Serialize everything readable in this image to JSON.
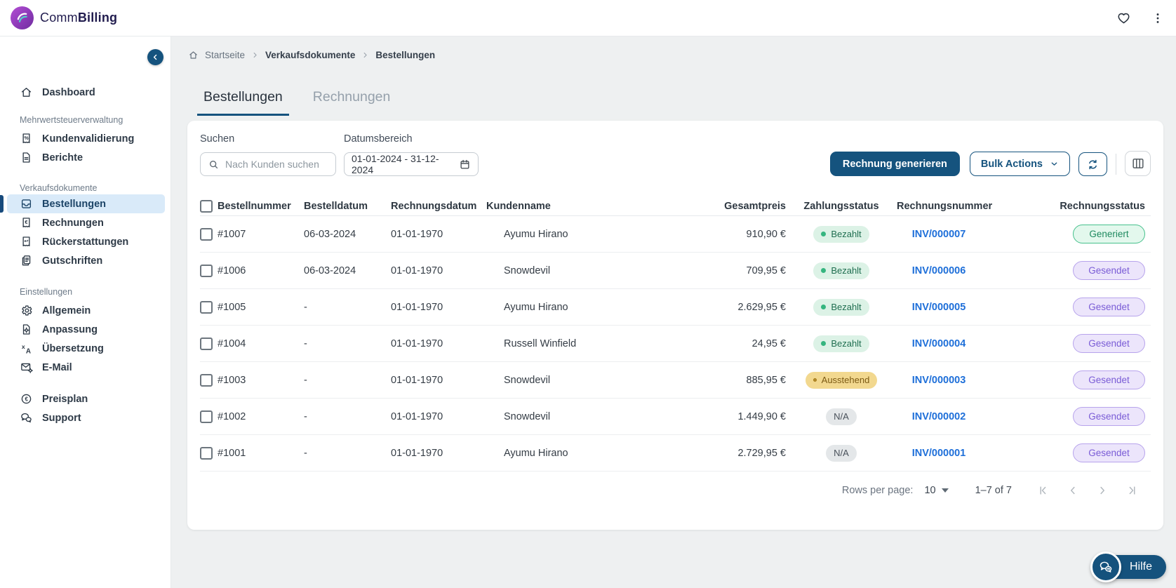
{
  "brand": {
    "comm": "Comm",
    "billing": "Billing"
  },
  "topbar": {
    "icons": [
      "heart-icon",
      "kebab-menu-icon"
    ]
  },
  "sidebar": {
    "collapse_icon": "chevron-left",
    "items": [
      {
        "type": "item",
        "label": "Dashboard",
        "icon": "home",
        "active": false,
        "gap": "mt14"
      },
      {
        "type": "section",
        "label": "Mehrwertsteuerverwaltung",
        "gap": "mt17"
      },
      {
        "type": "item",
        "label": "Kundenvalidierung",
        "icon": "receipt-percent",
        "active": false,
        "gap": "mt4"
      },
      {
        "type": "item",
        "label": "Berichte",
        "icon": "document",
        "active": false
      },
      {
        "type": "section",
        "label": "Verkaufsdokumente",
        "gap": "mt21"
      },
      {
        "type": "item",
        "label": "Bestellungen",
        "icon": "inbox",
        "active": true,
        "gap": "mt4"
      },
      {
        "type": "item",
        "label": "Rechnungen",
        "icon": "receipt-euro",
        "active": false
      },
      {
        "type": "item",
        "label": "Rückerstattungen",
        "icon": "receipt-refund",
        "active": false
      },
      {
        "type": "item",
        "label": "Gutschriften",
        "icon": "copy-note",
        "active": false
      },
      {
        "type": "section",
        "label": "Einstellungen",
        "gap": "mt22"
      },
      {
        "type": "item",
        "label": "Allgemein",
        "icon": "gear",
        "active": false,
        "gap": "mt4"
      },
      {
        "type": "item",
        "label": "Anpassung",
        "icon": "doc-gear",
        "active": false
      },
      {
        "type": "item",
        "label": "Übersetzung",
        "icon": "translate",
        "active": false
      },
      {
        "type": "item",
        "label": "E-Mail",
        "icon": "mail-gear",
        "active": false
      },
      {
        "type": "item",
        "label": "Preisplan",
        "icon": "euro-circle",
        "active": false,
        "gap": "mt18"
      },
      {
        "type": "item",
        "label": "Support",
        "icon": "chat",
        "active": false
      }
    ]
  },
  "breadcrumb": {
    "items": [
      "Startseite",
      "Verkaufsdokumente",
      "Bestellungen"
    ]
  },
  "tabs": [
    {
      "label": "Bestellungen",
      "active": true
    },
    {
      "label": "Rechnungen",
      "active": false
    }
  ],
  "filters": {
    "search_label": "Suchen",
    "search_placeholder": "Nach Kunden suchen",
    "date_label": "Datumsbereich",
    "date_value": "01-01-2024 - 31-12-2024"
  },
  "actions": {
    "generate_invoice": "Rechnung generieren",
    "bulk_actions": "Bulk Actions"
  },
  "table": {
    "columns": [
      "Bestellnummer",
      "Bestelldatum",
      "Rechnungsdatum",
      "Kundenname",
      "Gesamtpreis",
      "Zahlungsstatus",
      "Rechnungsnummer",
      "Rechnungsstatus"
    ],
    "rows": [
      {
        "order": "#1007",
        "order_date": "06-03-2024",
        "invoice_date": "01-01-1970",
        "customer": "Ayumu Hirano",
        "total": "910,90 €",
        "payment": "Bezahlt",
        "payment_type": "paid",
        "invoice": "INV/000007",
        "status": "Generiert",
        "status_type": "generated"
      },
      {
        "order": "#1006",
        "order_date": "06-03-2024",
        "invoice_date": "01-01-1970",
        "customer": "Snowdevil",
        "total": "709,95 €",
        "payment": "Bezahlt",
        "payment_type": "paid",
        "invoice": "INV/000006",
        "status": "Gesendet",
        "status_type": "sent"
      },
      {
        "order": "#1005",
        "order_date": "-",
        "invoice_date": "01-01-1970",
        "customer": "Ayumu Hirano",
        "total": "2.629,95 €",
        "payment": "Bezahlt",
        "payment_type": "paid",
        "invoice": "INV/000005",
        "status": "Gesendet",
        "status_type": "sent"
      },
      {
        "order": "#1004",
        "order_date": "-",
        "invoice_date": "01-01-1970",
        "customer": "Russell Winfield",
        "total": "24,95 €",
        "payment": "Bezahlt",
        "payment_type": "paid",
        "invoice": "INV/000004",
        "status": "Gesendet",
        "status_type": "sent"
      },
      {
        "order": "#1003",
        "order_date": "-",
        "invoice_date": "01-01-1970",
        "customer": "Snowdevil",
        "total": "885,95 €",
        "payment": "Ausstehend",
        "payment_type": "pending",
        "invoice": "INV/000003",
        "status": "Gesendet",
        "status_type": "sent"
      },
      {
        "order": "#1002",
        "order_date": "-",
        "invoice_date": "01-01-1970",
        "customer": "Snowdevil",
        "total": "1.449,90 €",
        "payment": "N/A",
        "payment_type": "na",
        "invoice": "INV/000002",
        "status": "Gesendet",
        "status_type": "sent"
      },
      {
        "order": "#1001",
        "order_date": "-",
        "invoice_date": "01-01-1970",
        "customer": "Ayumu Hirano",
        "total": "2.729,95 €",
        "payment": "N/A",
        "payment_type": "na",
        "invoice": "INV/000001",
        "status": "Gesendet",
        "status_type": "sent"
      }
    ]
  },
  "pagination": {
    "rows_per_page_label": "Rows per page:",
    "rows_per_page_value": "10",
    "range_label": "1–7 of 7"
  },
  "help": {
    "label": "Hilfe"
  },
  "colors": {
    "primary": "#15537e",
    "link_blue": "#1e6fd9",
    "sidebar_active_bg": "#d9eaf9",
    "paid_bg": "#dcf2e6",
    "paid_text": "#1f6e50",
    "paid_dot": "#35b57f",
    "pending_bg": "#f2d88f",
    "pending_text": "#7c5a13",
    "na_bg": "#e4e7e9",
    "na_text": "#49515a",
    "generated_bg": "#e3f8ed",
    "generated_border": "#46c08c",
    "generated_text": "#1f8a60",
    "sent_bg": "#ece5fb",
    "sent_border": "#b7a3ec",
    "sent_text": "#7a5cd6"
  }
}
